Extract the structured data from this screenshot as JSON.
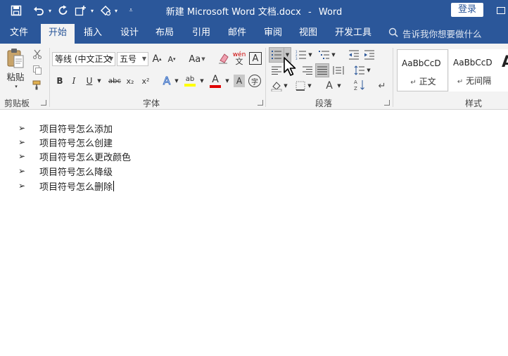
{
  "titlebar": {
    "title": "新建 Microsoft Word 文档.docx",
    "separator": "-",
    "app_name": "Word",
    "login_label": "登录",
    "background": "#2b579a"
  },
  "tabs": [
    {
      "label": "文件"
    },
    {
      "label": "开始",
      "active": true
    },
    {
      "label": "插入"
    },
    {
      "label": "设计"
    },
    {
      "label": "布局"
    },
    {
      "label": "引用"
    },
    {
      "label": "邮件"
    },
    {
      "label": "审阅"
    },
    {
      "label": "视图"
    },
    {
      "label": "开发工具"
    }
  ],
  "tell_me": {
    "placeholder": "告诉我你想要做什么"
  },
  "ribbon": {
    "clipboard": {
      "paste_label": "粘贴",
      "group_label": "剪贴板"
    },
    "font": {
      "font_name": "等线 (中文正文",
      "font_size": "五号",
      "case_label": "Aa",
      "phonetic_top": "wén",
      "phonetic_bottom": "文",
      "border_char": "A",
      "bold": "B",
      "italic": "I",
      "underline": "U",
      "strike": "abc",
      "subscript": "x₂",
      "superscript": "x²",
      "text_effects": "A",
      "highlight": "ab",
      "font_color": "A",
      "shading": "A",
      "enclose_char": "字",
      "group_label": "字体"
    },
    "paragraph": {
      "group_label": "段落"
    },
    "styles": {
      "items": [
        {
          "preview": "AaBbCcD",
          "label": "正文"
        },
        {
          "preview": "AaBbCcD",
          "label": "无间隔"
        }
      ],
      "overflow_preview": "A",
      "group_label": "样式"
    }
  },
  "document": {
    "bullet_symbol": "➢",
    "items": [
      "项目符号怎么添加",
      "项目符号怎么创建",
      "项目符号怎么更改颜色",
      "项目符号怎么降级",
      "项目符号怎么删除"
    ]
  }
}
